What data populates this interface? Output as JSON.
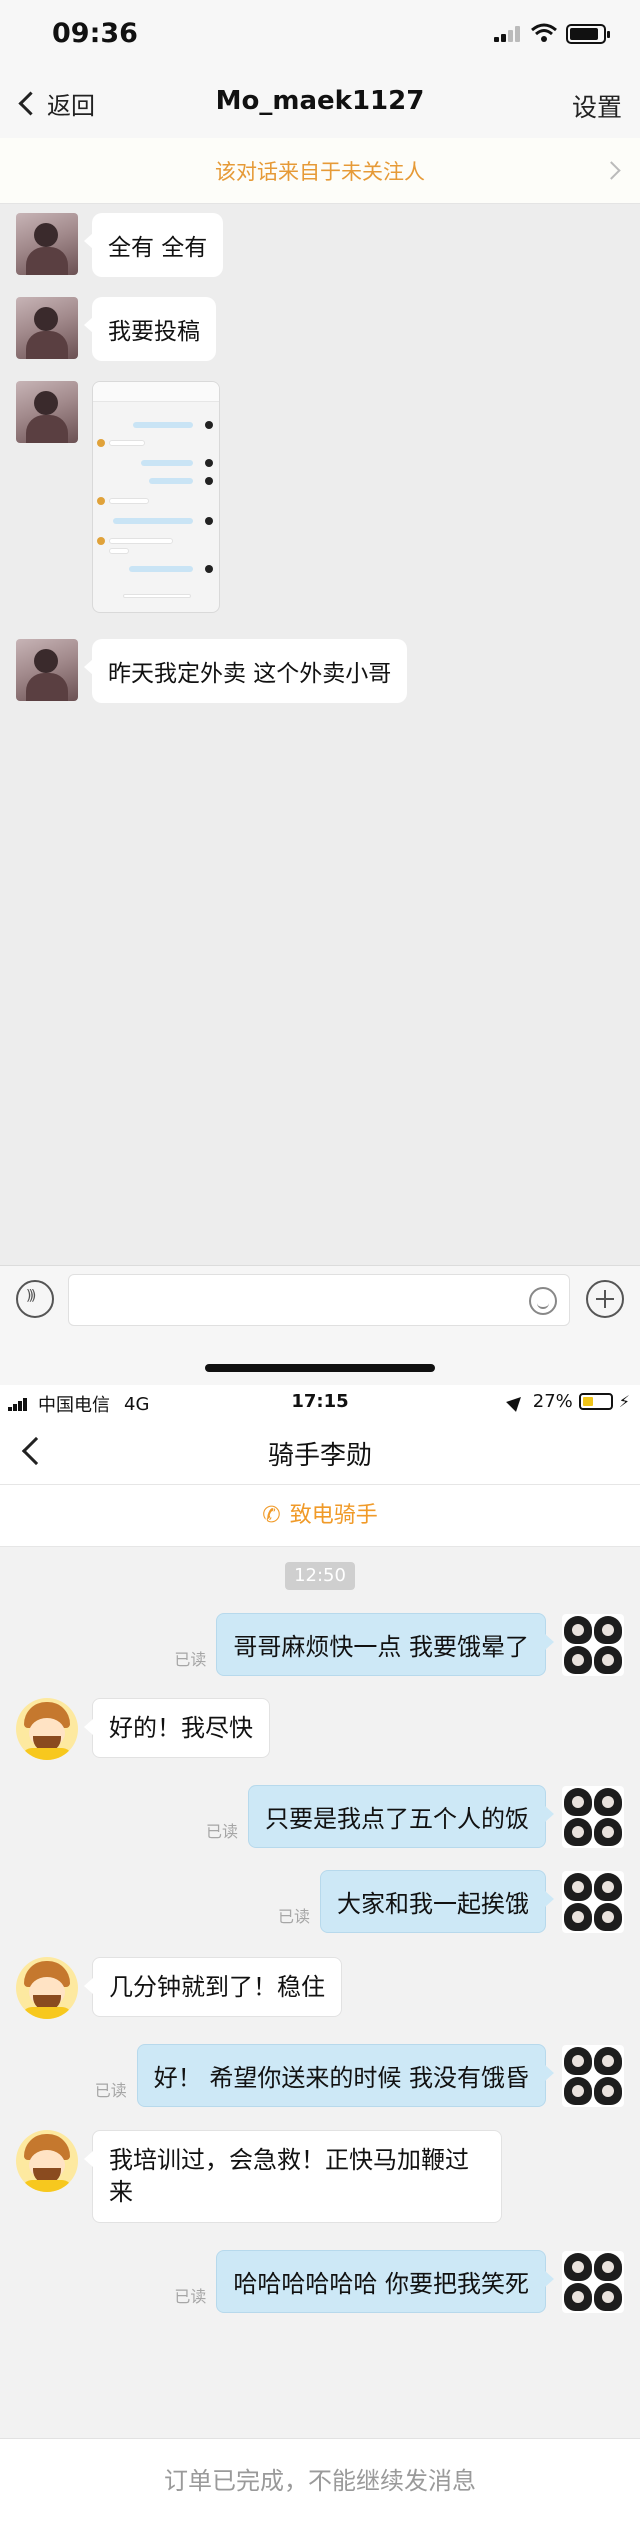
{
  "top": {
    "status": {
      "time": "09:36"
    },
    "nav": {
      "back_label": "返回",
      "title": "Mo_maek1127",
      "settings_label": "设置"
    },
    "notice": "该对话来自于未关注人",
    "messages": [
      {
        "type": "text",
        "text": "全有 全有"
      },
      {
        "type": "text",
        "text": "我要投稿"
      },
      {
        "type": "image"
      },
      {
        "type": "text",
        "text": "昨天我定外卖 这个外卖小哥"
      }
    ]
  },
  "bottom": {
    "status": {
      "carrier": "中国电信",
      "network": "4G",
      "time": "17:15",
      "battery": "27%"
    },
    "nav": {
      "title": "骑手李勋"
    },
    "call_label": "致电骑手",
    "timestamp": "12:50",
    "read_label": "已读",
    "messages": [
      {
        "side": "right",
        "text": "哥哥麻烦快一点 我要饿晕了"
      },
      {
        "side": "left",
        "text": "好的！我尽快"
      },
      {
        "side": "right",
        "text": "只要是我点了五个人的饭"
      },
      {
        "side": "right",
        "text": "大家和我一起挨饿"
      },
      {
        "side": "left",
        "text": "几分钟就到了！稳住"
      },
      {
        "side": "right",
        "text": "好！ 希望你送来的时候 我没有饿昏"
      },
      {
        "side": "left",
        "text": "我培训过，会急救！正快马加鞭过来"
      },
      {
        "side": "right",
        "text": "哈哈哈哈哈哈 你要把我笑死"
      }
    ],
    "footer": "订单已完成，不能继续发消息"
  },
  "colors": {
    "accent_orange": "#f09a28",
    "notice_orange": "#e69a37",
    "sent_bubble": "#cde8f6"
  },
  "icons": [
    "back-chevron-icon",
    "signal-icon",
    "wifi-icon",
    "battery-icon",
    "voice-icon",
    "emoji-icon",
    "plus-icon",
    "phone-icon",
    "location-icon",
    "charging-icon"
  ]
}
